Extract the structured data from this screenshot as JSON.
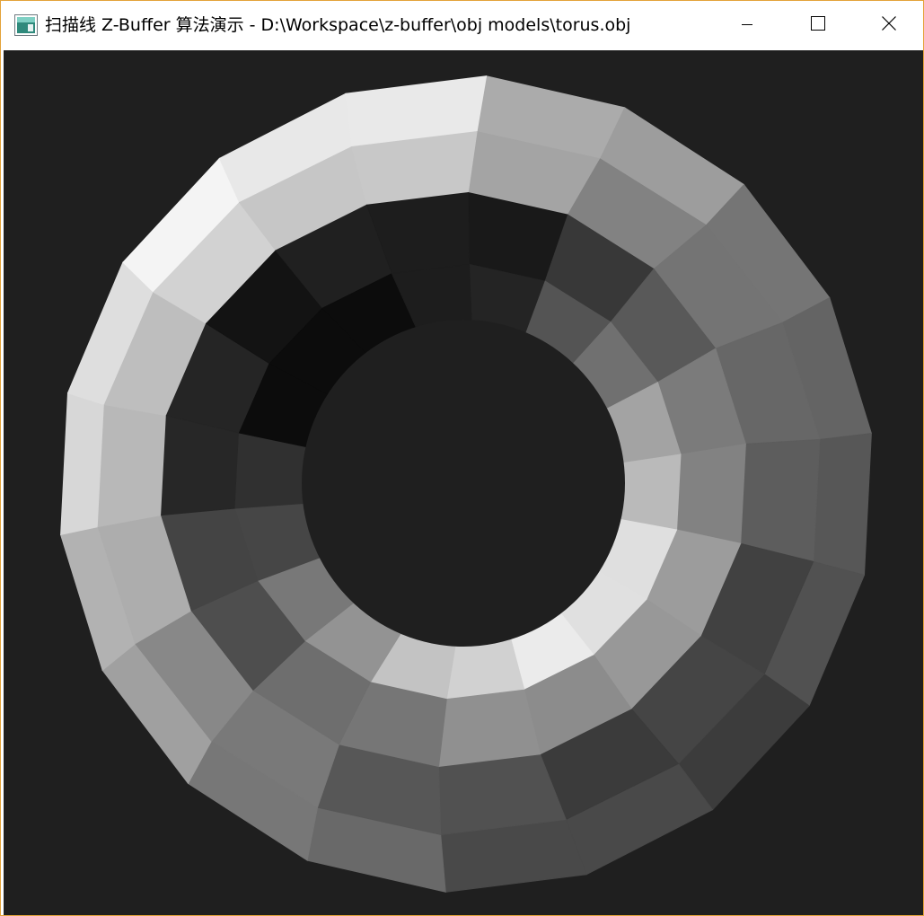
{
  "window": {
    "title": "扫描线 Z-Buffer 算法演示 - D:\\Workspace\\z-buffer\\obj models\\torus.obj",
    "icon": "app-icon",
    "controls": [
      "minimize-icon",
      "maximize-icon",
      "close-icon"
    ]
  },
  "viewport": {
    "background": "#1f1f1f",
    "model": "torus",
    "segments": 18,
    "rings": 4
  },
  "colors": {
    "border": "#e3a33a"
  }
}
